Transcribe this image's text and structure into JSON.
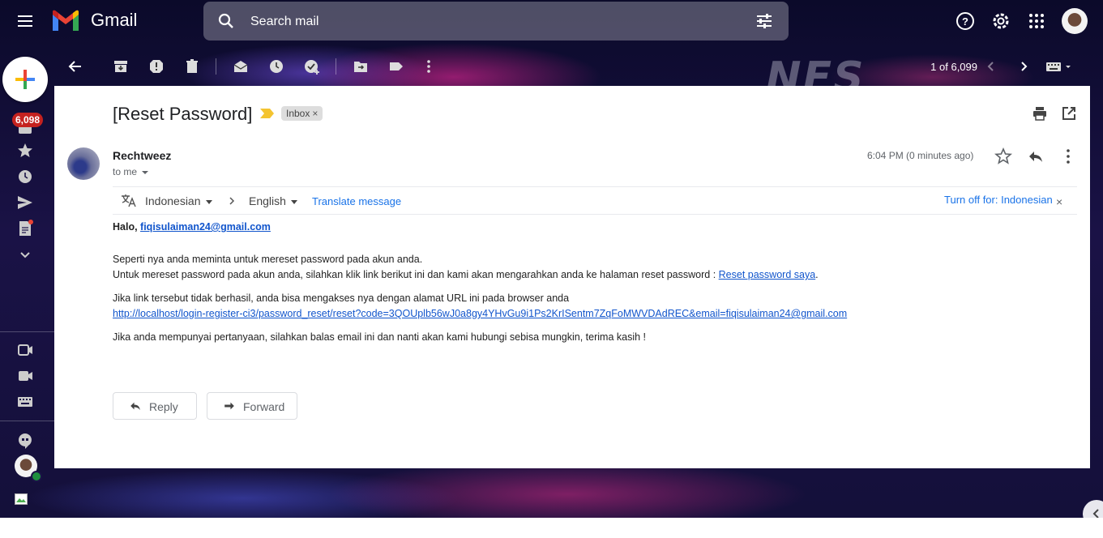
{
  "app": {
    "name": "Gmail"
  },
  "search": {
    "placeholder": "Search mail"
  },
  "toolbar": {
    "page_count": "1 of 6,099"
  },
  "sidebar": {
    "inbox_count": "6,098"
  },
  "message": {
    "subject": "[Reset Password]",
    "label": "Inbox",
    "sender": "Rechtweez",
    "to": "to me",
    "time": "6:04 PM (0 minutes ago)"
  },
  "translate": {
    "from_lang": "Indonesian",
    "to_lang": "English",
    "translate_link": "Translate message",
    "turn_off": "Turn off for: Indonesian"
  },
  "body": {
    "greeting": "Halo,",
    "email": "fiqisulaiman24@gmail.com",
    "line1": "Seperti nya anda meminta untuk mereset password pada akun anda.",
    "line2": "Untuk mereset password pada akun anda, silahkan klik link berikut ini dan kami akan mengarahkan anda ke halaman reset password :",
    "reset_link": "Reset password saya",
    "line3": "Jika link tersebut tidak berhasil, anda bisa mengakses nya dengan alamat URL ini pada browser anda",
    "url": "http://localhost/login-register-ci3/password_reset/reset?code=3QOUplb56wJ0a8gy4YHvGu9i1Ps2KrISentm7ZqFoMWVDAdREC&email=fiqisulaiman24@gmail.com",
    "line4": "Jika anda mempunyai pertanyaan, silahkan balas email ini dan nanti akan kami hubungi sebisa mungkin, terima kasih !"
  },
  "buttons": {
    "reply": "Reply",
    "forward": "Forward"
  },
  "colors": {
    "link": "#1155cc",
    "badge": "#c5221f",
    "importance": "#f4c430"
  }
}
